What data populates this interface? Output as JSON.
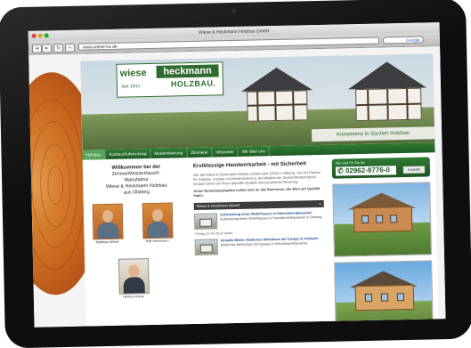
{
  "browser": {
    "window_title": "Wiese & Heckmann Holzbau GmbH",
    "url": "www.wiese-hz.de",
    "search_label": "Google"
  },
  "logo": {
    "word1": "wiese",
    "word2": "heckmann",
    "since": "Seit 1933",
    "subtitle": "HOLZBAU."
  },
  "slogan": "Kompetenz in Sachen Holzbau",
  "nav": {
    "items": [
      {
        "label": "Holzbau"
      },
      {
        "label": "Ausbau/Aufstockung"
      },
      {
        "label": "Modernisierung"
      },
      {
        "label": "Zimmerei"
      },
      {
        "label": "Infocenter"
      },
      {
        "label": "Wir über uns"
      }
    ]
  },
  "welcome": {
    "line1": "Willkommen bei der",
    "line2": "ZimmerMeisterHaus®-",
    "line3": "Manufaktur",
    "line4": "Wiese & Heckmann Holzbau",
    "line5": "aus Olsberg"
  },
  "team": [
    {
      "name": "Matthias Wiese"
    },
    {
      "name": "Ralf Heckmann"
    },
    {
      "name": "Helmut Wiese"
    }
  ],
  "main": {
    "headline": "Erstklassige Handwerkarbeit - mit Sicherheit",
    "para1": "Wir, die Wiese & Heckmann Holzbau GmbH (seit 1933) in Olsberg, sind Ihr Partner für Holzbau, Ausbau und Modernisierung. Als Mitglied der ZimmerMeisterHaus®-Gruppe bieten wir Ihnen geprüfte Qualität und persönliche Beratung.",
    "para2": "Unser Beratungsangebot richtet sich an alle Bauherren, die Wert auf Qualität legen.",
    "news_heading": "Wiese & Heckmann Aktuell",
    "news_arrow": "»",
    "news": [
      {
        "title": "Aufstockung eines Wohnhauses in Holzrahmenbauweise",
        "text": "Aufstockung eines Wohnhauses in Holzrahmenbauweise in Olsberg."
      },
      {
        "title": "Aktuelle Bilder: Modernes Wohnhaus mit Garage in Schwelm",
        "text": "Modernes Wohnhaus mit Garage in Holzrahmenbauweise."
      }
    ],
    "news_date": "Freitag 23.06.2013 weiter..."
  },
  "contact": {
    "label": "Wir sind für Sie da",
    "phone": "02962-9776-0",
    "button": "Kontakt"
  }
}
